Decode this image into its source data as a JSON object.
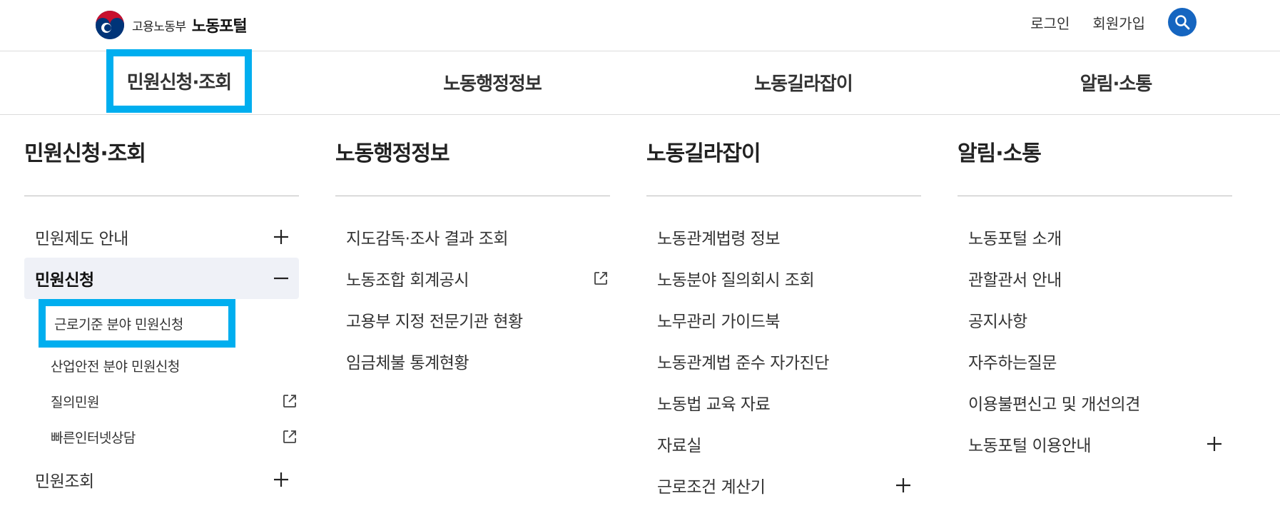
{
  "header": {
    "ministry_name": "고용노동부",
    "portal_name": "노동포털",
    "login": "로그인",
    "signup": "회원가입",
    "brand_colors": {
      "accent": "#1565c0",
      "highlight": "#00aeef",
      "logo_red": "#c8102e",
      "logo_blue": "#003478"
    }
  },
  "gnb": {
    "items": [
      "민원신청·조회",
      "노동행정정보",
      "노동길라잡이",
      "알림·소통"
    ],
    "active_index": 0
  },
  "columns": {
    "c0": {
      "title": "민원신청·조회",
      "items": [
        {
          "label": "민원제도 안내",
          "icon": "plus-icon"
        },
        {
          "label": "민원신청",
          "icon": "minus-icon",
          "expanded": true,
          "children": [
            {
              "label": "근로기준 분야 민원신청"
            },
            {
              "label": "산업안전 분야 민원신청"
            },
            {
              "label": "질의민원",
              "icon": "external-link-icon"
            },
            {
              "label": "빠른인터넷상담",
              "icon": "external-link-icon"
            }
          ]
        },
        {
          "label": "민원조회",
          "icon": "plus-icon"
        }
      ]
    },
    "c1": {
      "title": "노동행정정보",
      "items": [
        {
          "label": "지도감독·조사 결과 조회"
        },
        {
          "label": "노동조합 회계공시",
          "icon": "external-link-icon"
        },
        {
          "label": "고용부 지정 전문기관 현황"
        },
        {
          "label": "임금체불 통계현황"
        }
      ]
    },
    "c2": {
      "title": "노동길라잡이",
      "items": [
        {
          "label": "노동관계법령 정보"
        },
        {
          "label": "노동분야 질의회시 조회"
        },
        {
          "label": "노무관리 가이드북"
        },
        {
          "label": "노동관계법 준수 자가진단"
        },
        {
          "label": "노동법 교육 자료"
        },
        {
          "label": "자료실"
        },
        {
          "label": "근로조건 계산기",
          "icon": "plus-icon"
        }
      ]
    },
    "c3": {
      "title": "알림·소통",
      "items": [
        {
          "label": "노동포털 소개"
        },
        {
          "label": "관할관서 안내"
        },
        {
          "label": "공지사항"
        },
        {
          "label": "자주하는질문"
        },
        {
          "label": "이용불편신고 및 개선의견"
        },
        {
          "label": "노동포털 이용안내",
          "icon": "plus-icon"
        }
      ]
    }
  }
}
